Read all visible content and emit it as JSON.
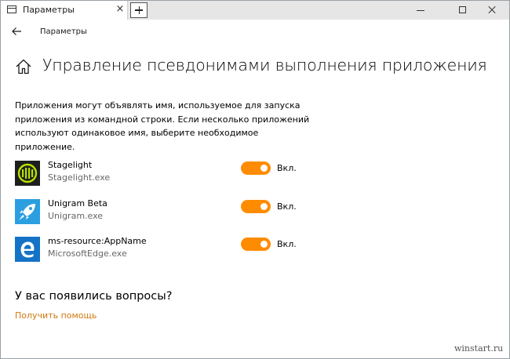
{
  "window": {
    "tab_title": "Параметры",
    "tab_close_glyph": "×"
  },
  "nav": {
    "title": "Параметры"
  },
  "page": {
    "title": "Управление псевдонимами выполнения приложения",
    "description": "Приложения могут объявлять имя, используемое для запуска приложения из командной строки. Если несколько приложений используют одинаковое имя, выберите необходимое приложение."
  },
  "apps": [
    {
      "name": "Stagelight",
      "exe": "Stagelight.exe",
      "toggle_state": "Вкл.",
      "enabled": true,
      "icon": "stagelight-icon"
    },
    {
      "name": "Unigram Beta",
      "exe": "Unigram.exe",
      "toggle_state": "Вкл.",
      "enabled": true,
      "icon": "rocket-icon"
    },
    {
      "name": "ms-resource:AppName",
      "exe": "MicrosoftEdge.exe",
      "toggle_state": "Вкл.",
      "enabled": true,
      "icon": "edge-icon"
    }
  ],
  "help": {
    "title": "У вас появились вопросы?",
    "link": "Получить помощь"
  },
  "watermark": "winstart.ru",
  "colors": {
    "accent": "#ff8c00",
    "link": "#d2780f",
    "stagelight_bg": "#1e1e1e",
    "stagelight_fg": "#b7e000",
    "unigram_bg": "#2b9fe0",
    "edge_bg": "#1573c6"
  }
}
